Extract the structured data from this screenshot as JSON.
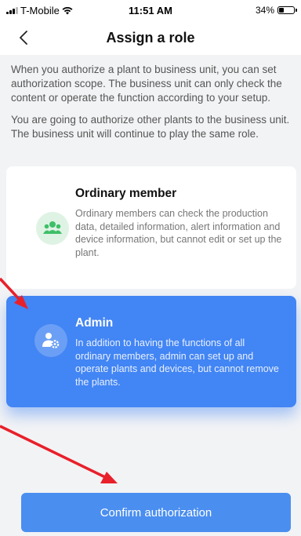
{
  "status_bar": {
    "carrier": "T-Mobile",
    "time": "11:51 AM",
    "battery": "34%",
    "battery_level": 0.34,
    "wifi_icon": "wifi-icon"
  },
  "nav": {
    "title": "Assign a role",
    "back_icon": "chevron-left-icon"
  },
  "intro": {
    "paragraph1": "When you authorize a plant to business unit, you can set authorization scope. The business unit can only check the content or operate the function according to your setup.",
    "paragraph2": "You are going to authorize other plants to the business unit. The business unit will continue to play the same role."
  },
  "roles": [
    {
      "title": "Ordinary member",
      "description": "Ordinary members can check the production data, detailed information, alert information and device information, but cannot edit or set up the plant.",
      "icon": "group-icon",
      "selected": false
    },
    {
      "title": "Admin",
      "description": "In addition to having the functions of all ordinary members, admin can set up and operate plants and devices, but cannot remove the plants.",
      "icon": "admin-gear-icon",
      "selected": true
    }
  ],
  "confirm_button": {
    "label": "Confirm authorization"
  },
  "colors": {
    "accent": "#4285f4",
    "annotation": "#e8202a"
  }
}
